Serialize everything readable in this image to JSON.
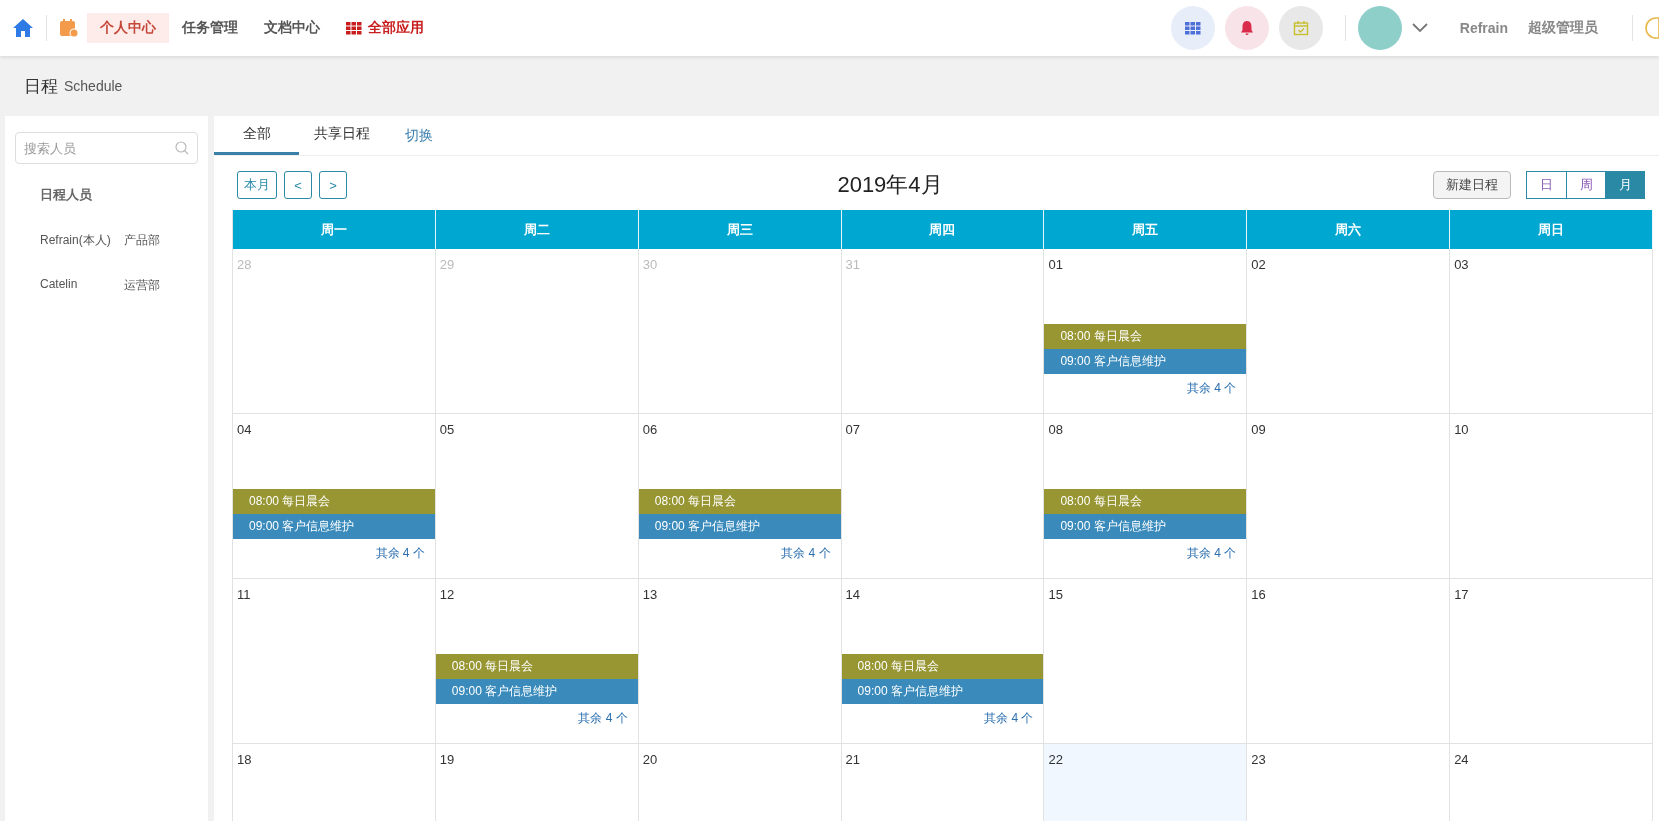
{
  "top_nav": {
    "items": [
      {
        "label": "个人中心",
        "selected": true,
        "kind": "plain"
      },
      {
        "label": "任务管理",
        "selected": false,
        "kind": "plain"
      },
      {
        "label": "文档中心",
        "selected": false,
        "kind": "plain"
      },
      {
        "label": "全部应用",
        "selected": false,
        "kind": "apps"
      }
    ],
    "user_name": "Refrain",
    "user_role": "超级管理员"
  },
  "page_header": {
    "title": "日程",
    "subtitle": "Schedule"
  },
  "sidebar": {
    "search": {
      "placeholder": "搜索人员"
    },
    "heading": "日程人员",
    "people": [
      {
        "name": "Refrain(本人)",
        "dept": "产品部"
      },
      {
        "name": "Catelin",
        "dept": "运营部"
      }
    ]
  },
  "tabs": [
    {
      "label": "全部",
      "selected": true
    },
    {
      "label": "共享日程",
      "selected": false
    }
  ],
  "switch_link": "切换",
  "toolbar": {
    "this_month": "本月",
    "prev": "<",
    "next": ">",
    "title": "2019年4月",
    "new_button": "新建日程",
    "views": [
      {
        "label": "日",
        "selected": false
      },
      {
        "label": "周",
        "selected": false
      },
      {
        "label": "月",
        "selected": true
      }
    ]
  },
  "weekdays": [
    "周一",
    "周二",
    "周三",
    "周四",
    "周五",
    "周六",
    "周日"
  ],
  "weeks": [
    [
      {
        "day": "28",
        "muted": true
      },
      {
        "day": "29",
        "muted": true
      },
      {
        "day": "30",
        "muted": true
      },
      {
        "day": "31",
        "muted": true
      },
      {
        "day": "01",
        "muted": false,
        "events": [
          {
            "label": "08:00 每日晨会",
            "color": "#979632"
          },
          {
            "label": "09:00 客户信息维护",
            "color": "#3a8bbb"
          }
        ],
        "more": "其余 4 个"
      },
      {
        "day": "02",
        "muted": false
      },
      {
        "day": "03",
        "muted": false
      }
    ],
    [
      {
        "day": "04",
        "muted": false,
        "events": [
          {
            "label": "08:00 每日晨会",
            "color": "#979632"
          },
          {
            "label": "09:00 客户信息维护",
            "color": "#3a8bbb"
          }
        ],
        "more": "其余 4 个"
      },
      {
        "day": "05",
        "muted": false
      },
      {
        "day": "06",
        "muted": false,
        "events": [
          {
            "label": "08:00 每日晨会",
            "color": "#979632"
          },
          {
            "label": "09:00 客户信息维护",
            "color": "#3a8bbb"
          }
        ],
        "more": "其余 4 个"
      },
      {
        "day": "07",
        "muted": false
      },
      {
        "day": "08",
        "muted": false,
        "events": [
          {
            "label": "08:00 每日晨会",
            "color": "#979632"
          },
          {
            "label": "09:00 客户信息维护",
            "color": "#3a8bbb"
          }
        ],
        "more": "其余 4 个"
      },
      {
        "day": "09",
        "muted": false
      },
      {
        "day": "10",
        "muted": false
      }
    ],
    [
      {
        "day": "11",
        "muted": false
      },
      {
        "day": "12",
        "muted": false,
        "events": [
          {
            "label": "08:00 每日晨会",
            "color": "#979632"
          },
          {
            "label": "09:00 客户信息维护",
            "color": "#3a8bbb"
          }
        ],
        "more": "其余 4 个"
      },
      {
        "day": "13",
        "muted": false
      },
      {
        "day": "14",
        "muted": false,
        "events": [
          {
            "label": "08:00 每日晨会",
            "color": "#979632"
          },
          {
            "label": "09:00 客户信息维护",
            "color": "#3a8bbb"
          }
        ],
        "more": "其余 4 个"
      },
      {
        "day": "15",
        "muted": false
      },
      {
        "day": "16",
        "muted": false
      },
      {
        "day": "17",
        "muted": false
      }
    ],
    [
      {
        "day": "18",
        "muted": false
      },
      {
        "day": "19",
        "muted": false
      },
      {
        "day": "20",
        "muted": false
      },
      {
        "day": "21",
        "muted": false
      },
      {
        "day": "22",
        "muted": false,
        "today": true
      },
      {
        "day": "23",
        "muted": false
      },
      {
        "day": "24",
        "muted": false
      }
    ]
  ]
}
